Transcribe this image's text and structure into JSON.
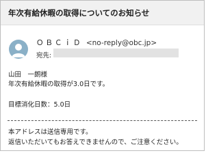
{
  "email": {
    "subject": "年次有給休暇の取得についてのお知らせ",
    "sender_name": "ＯＢＣｉＤ",
    "sender_address": "<no-reply@obc.jp>",
    "to_label": "宛先:",
    "greeting": "山田　一朗様",
    "line1": "年次有給休暇の取得が3.0日です。",
    "line2": "目標消化日数：5.0日",
    "footer1": "本アドレスは送信専用です。",
    "footer2": "返信いただいてもお答えできませんので、ご注意ください。"
  },
  "icons": {
    "avatar": "person-icon"
  },
  "colors": {
    "avatar_bg": "#8ab0c7",
    "header_bg": "#f1f1f1"
  }
}
